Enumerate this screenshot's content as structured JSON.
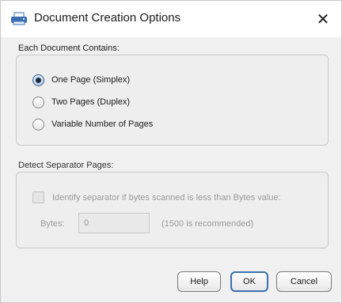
{
  "window": {
    "title": "Document Creation Options",
    "close_glyph": "✕",
    "icon": "scanner-icon"
  },
  "document_group": {
    "label": "Each Document Contains:",
    "options": [
      {
        "label": "One Page (Simplex)",
        "checked": true
      },
      {
        "label": "Two Pages (Duplex)",
        "checked": false
      },
      {
        "label": "Variable Number of Pages",
        "checked": false
      }
    ]
  },
  "separator_group": {
    "label": "Detect Separator Pages:",
    "checkbox_label": "Identify separator if bytes scanned is less than Bytes value:",
    "checkbox_checked": false,
    "bytes_label": "Bytes:",
    "bytes_value": "0",
    "bytes_hint": "(1500 is recommended)",
    "enabled": false
  },
  "buttons": {
    "help": "Help",
    "ok": "OK",
    "cancel": "Cancel"
  },
  "colors": {
    "accent": "#3a6fb0",
    "disabled_text": "#9a9a9a"
  }
}
